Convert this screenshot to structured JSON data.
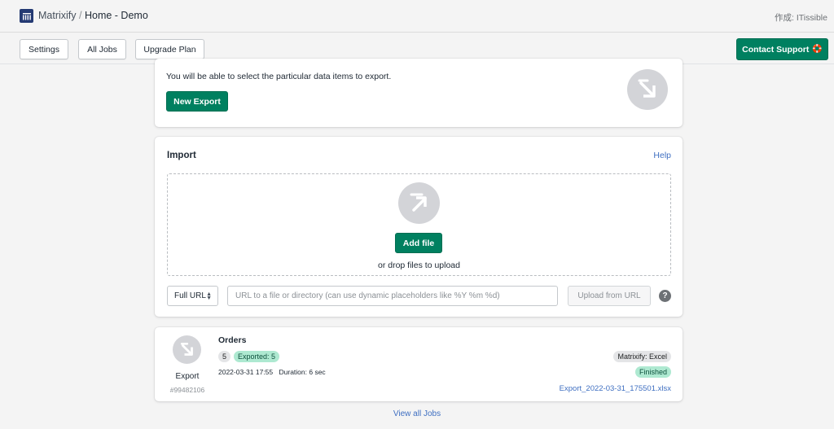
{
  "header": {
    "app_name": "Matrixify",
    "separator": "/",
    "page": "Home - Demo",
    "author": "作成: ITissible",
    "logo_icon": "matrixify-logo-icon"
  },
  "toolbar": {
    "settings_label": "Settings",
    "all_jobs_label": "All Jobs",
    "upgrade_label": "Upgrade Plan",
    "contact_label": "Contact Support",
    "contact_icon": "🛟"
  },
  "export_card": {
    "description": "You will be able to select the particular data items to export.",
    "button_label": "New Export",
    "icon": "export-arrow-icon"
  },
  "import_card": {
    "title": "Import",
    "help_label": "Help",
    "add_file_label": "Add file",
    "drop_text": "or drop files to upload",
    "url_type": "Full URL",
    "url_placeholder": "URL to a file or directory (can use dynamic placeholders like %Y %m %d)",
    "upload_label": "Upload from URL",
    "help_icon_glyph": "?",
    "icon": "import-arrow-icon"
  },
  "job": {
    "title": "Orders",
    "count": "5",
    "exported_badge": "Exported: 5",
    "timestamp": "2022-03-31 17:55",
    "duration": "Duration: 6 sec",
    "type_label": "Export",
    "job_id": "#99482106",
    "format_badge": "Matrixify: Excel",
    "status_badge": "Finished",
    "file_link": "Export_2022-03-31_175501.xlsx"
  },
  "footer": {
    "view_all_label": "View all Jobs"
  },
  "colors": {
    "primary": "#008060",
    "link": "#3f6fc1",
    "success_badge": "#aee9d1",
    "neutral_badge": "#e4e5e7"
  }
}
